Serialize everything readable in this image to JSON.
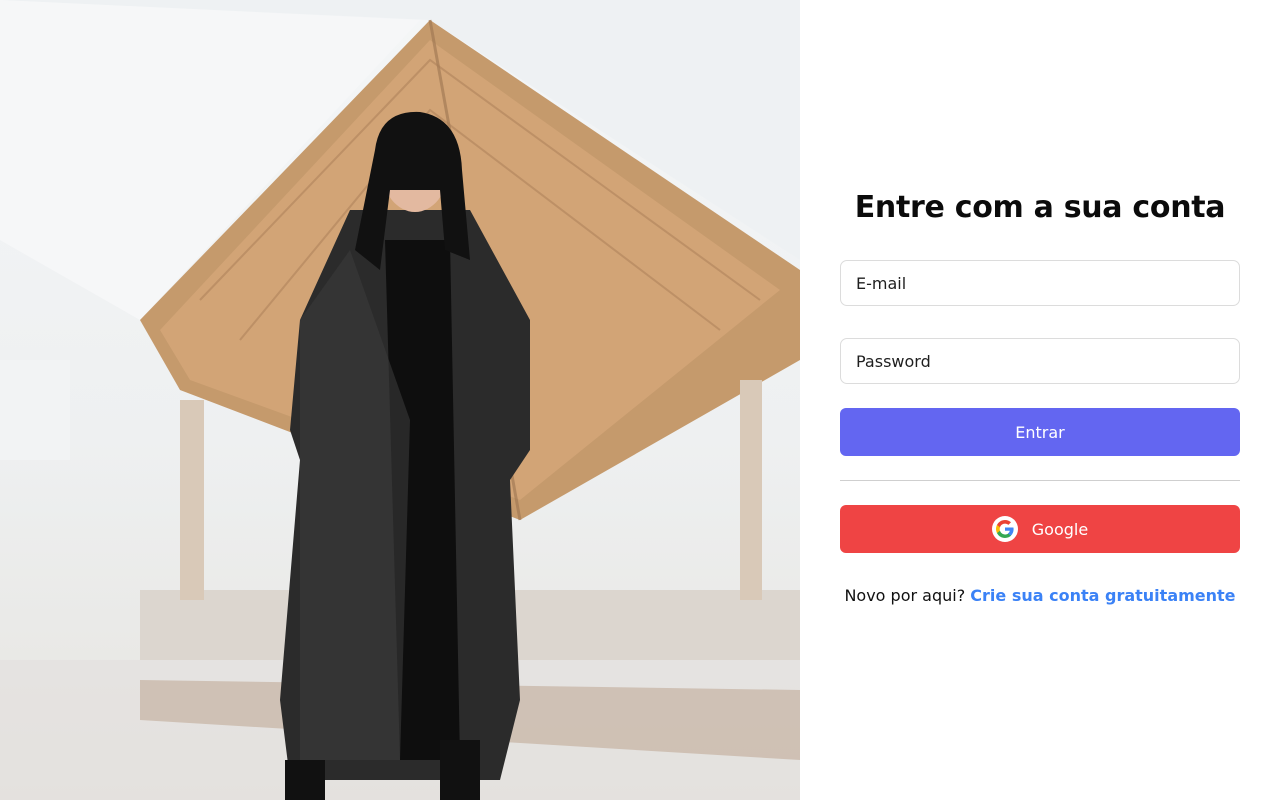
{
  "hero": {
    "image_subject": "woman-in-leather-coat-photo"
  },
  "login": {
    "title": "Entre com a sua conta",
    "email_placeholder": "E-mail",
    "password_placeholder": "Password",
    "enter_label": "Entrar",
    "google_label": "Google",
    "signup_prompt": "Novo por aqui?",
    "signup_link": "Crie sua conta gratuitamente"
  },
  "colors": {
    "enter_button": "#6366f1",
    "google_button": "#ef4444",
    "link": "#3b82f6"
  },
  "icons": {
    "google": "google-g-icon"
  }
}
